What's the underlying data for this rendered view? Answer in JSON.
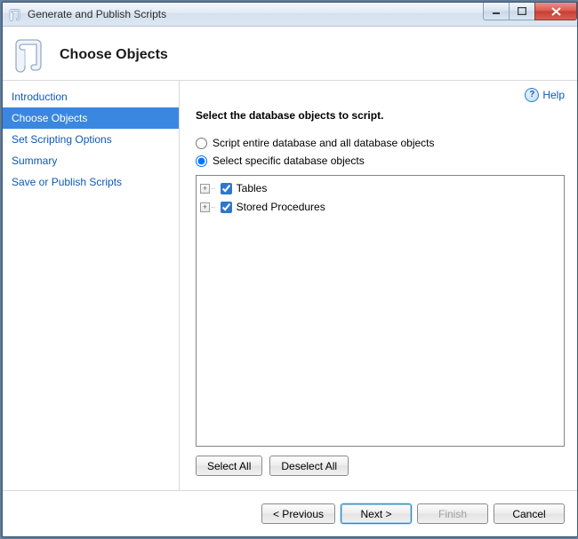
{
  "window": {
    "title": "Generate and Publish Scripts"
  },
  "header": {
    "heading": "Choose Objects"
  },
  "sidebar": {
    "items": [
      {
        "label": "Introduction",
        "selected": false
      },
      {
        "label": "Choose Objects",
        "selected": true
      },
      {
        "label": "Set Scripting Options",
        "selected": false
      },
      {
        "label": "Summary",
        "selected": false
      },
      {
        "label": "Save or Publish Scripts",
        "selected": false
      }
    ]
  },
  "content": {
    "help_label": "Help",
    "instruction": "Select the database objects to script.",
    "radio_options": [
      {
        "label": "Script entire database and all database objects",
        "checked": false
      },
      {
        "label": "Select specific database objects",
        "checked": true
      }
    ],
    "tree": [
      {
        "label": "Tables",
        "checked": true,
        "expandable": true
      },
      {
        "label": "Stored Procedures",
        "checked": true,
        "expandable": true
      }
    ],
    "select_all_label": "Select All",
    "deselect_all_label": "Deselect All"
  },
  "footer": {
    "previous_label": "< Previous",
    "next_label": "Next >",
    "finish_label": "Finish",
    "cancel_label": "Cancel"
  }
}
